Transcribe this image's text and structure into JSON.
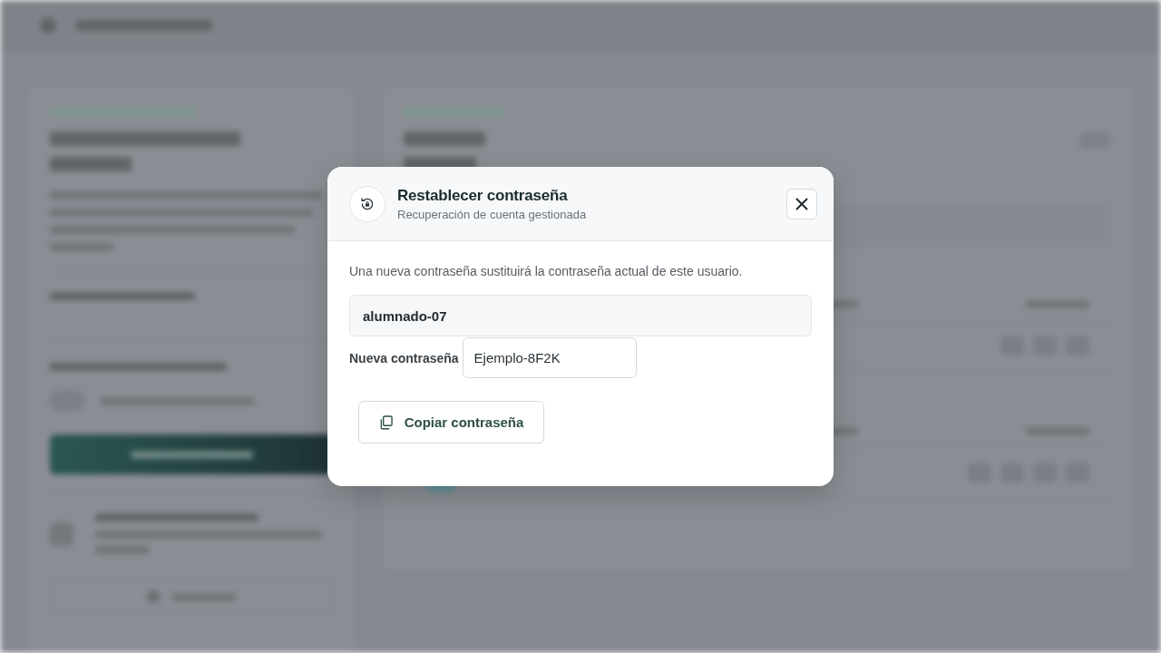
{
  "dialog": {
    "title": "Restablecer contraseña",
    "subtitle": "Recuperación de cuenta gestionada",
    "description": "Una nueva contraseña sustituirá la contraseña actual de este usuario.",
    "username": "alumnado-07",
    "password_field": {
      "label": "Nueva contraseña",
      "value": "Ejemplo-8F2K"
    },
    "actions": [
      {
        "kind": "copy",
        "label": "Copiar contraseña"
      }
    ]
  }
}
